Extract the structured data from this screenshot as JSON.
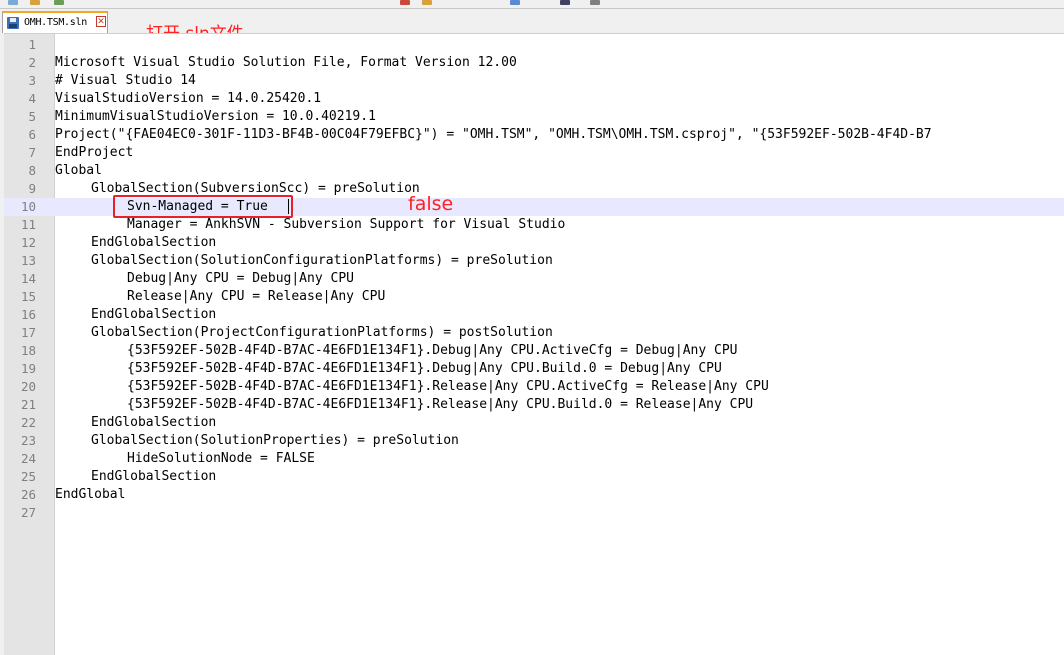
{
  "colors": {
    "annotation": "#ff2020",
    "active_line": "#e8e8ff",
    "tab_accent": "#f5a623"
  },
  "tab": {
    "label": "OMH.TSM.sln",
    "save_icon": "save-icon",
    "close_icon": "close-icon"
  },
  "annotations": {
    "title": "打开.sln文件",
    "note": "false"
  },
  "editor": {
    "active_line": 10,
    "lines": [
      {
        "n": "1",
        "indent": 0,
        "text": ""
      },
      {
        "n": "2",
        "indent": 0,
        "text": "Microsoft Visual Studio Solution File, Format Version 12.00"
      },
      {
        "n": "3",
        "indent": 0,
        "text": "# Visual Studio 14"
      },
      {
        "n": "4",
        "indent": 0,
        "text": "VisualStudioVersion = 14.0.25420.1"
      },
      {
        "n": "5",
        "indent": 0,
        "text": "MinimumVisualStudioVersion = 10.0.40219.1"
      },
      {
        "n": "6",
        "indent": 0,
        "text": "Project(\"{FAE04EC0-301F-11D3-BF4B-00C04F79EFBC}\") = \"OMH.TSM\", \"OMH.TSM\\OMH.TSM.csproj\", \"{53F592EF-502B-4F4D-B7"
      },
      {
        "n": "7",
        "indent": 0,
        "text": "EndProject"
      },
      {
        "n": "8",
        "indent": 0,
        "text": "Global"
      },
      {
        "n": "9",
        "indent": 1,
        "text": "GlobalSection(SubversionScc) = preSolution"
      },
      {
        "n": "10",
        "indent": 2,
        "text": "Svn-Managed = True"
      },
      {
        "n": "11",
        "indent": 2,
        "text": "Manager = AnkhSVN - Subversion Support for Visual Studio"
      },
      {
        "n": "12",
        "indent": 1,
        "text": "EndGlobalSection"
      },
      {
        "n": "13",
        "indent": 1,
        "text": "GlobalSection(SolutionConfigurationPlatforms) = preSolution"
      },
      {
        "n": "14",
        "indent": 2,
        "text": "Debug|Any CPU = Debug|Any CPU"
      },
      {
        "n": "15",
        "indent": 2,
        "text": "Release|Any CPU = Release|Any CPU"
      },
      {
        "n": "16",
        "indent": 1,
        "text": "EndGlobalSection"
      },
      {
        "n": "17",
        "indent": 1,
        "text": "GlobalSection(ProjectConfigurationPlatforms) = postSolution"
      },
      {
        "n": "18",
        "indent": 2,
        "text": "{53F592EF-502B-4F4D-B7AC-4E6FD1E134F1}.Debug|Any CPU.ActiveCfg = Debug|Any CPU"
      },
      {
        "n": "19",
        "indent": 2,
        "text": "{53F592EF-502B-4F4D-B7AC-4E6FD1E134F1}.Debug|Any CPU.Build.0 = Debug|Any CPU"
      },
      {
        "n": "20",
        "indent": 2,
        "text": "{53F592EF-502B-4F4D-B7AC-4E6FD1E134F1}.Release|Any CPU.ActiveCfg = Release|Any CPU"
      },
      {
        "n": "21",
        "indent": 2,
        "text": "{53F592EF-502B-4F4D-B7AC-4E6FD1E134F1}.Release|Any CPU.Build.0 = Release|Any CPU"
      },
      {
        "n": "22",
        "indent": 1,
        "text": "EndGlobalSection"
      },
      {
        "n": "23",
        "indent": 1,
        "text": "GlobalSection(SolutionProperties) = preSolution"
      },
      {
        "n": "24",
        "indent": 2,
        "text": "HideSolutionNode = FALSE"
      },
      {
        "n": "25",
        "indent": 1,
        "text": "EndGlobalSection"
      },
      {
        "n": "26",
        "indent": 0,
        "text": "EndGlobal"
      },
      {
        "n": "27",
        "indent": 0,
        "text": ""
      }
    ]
  }
}
